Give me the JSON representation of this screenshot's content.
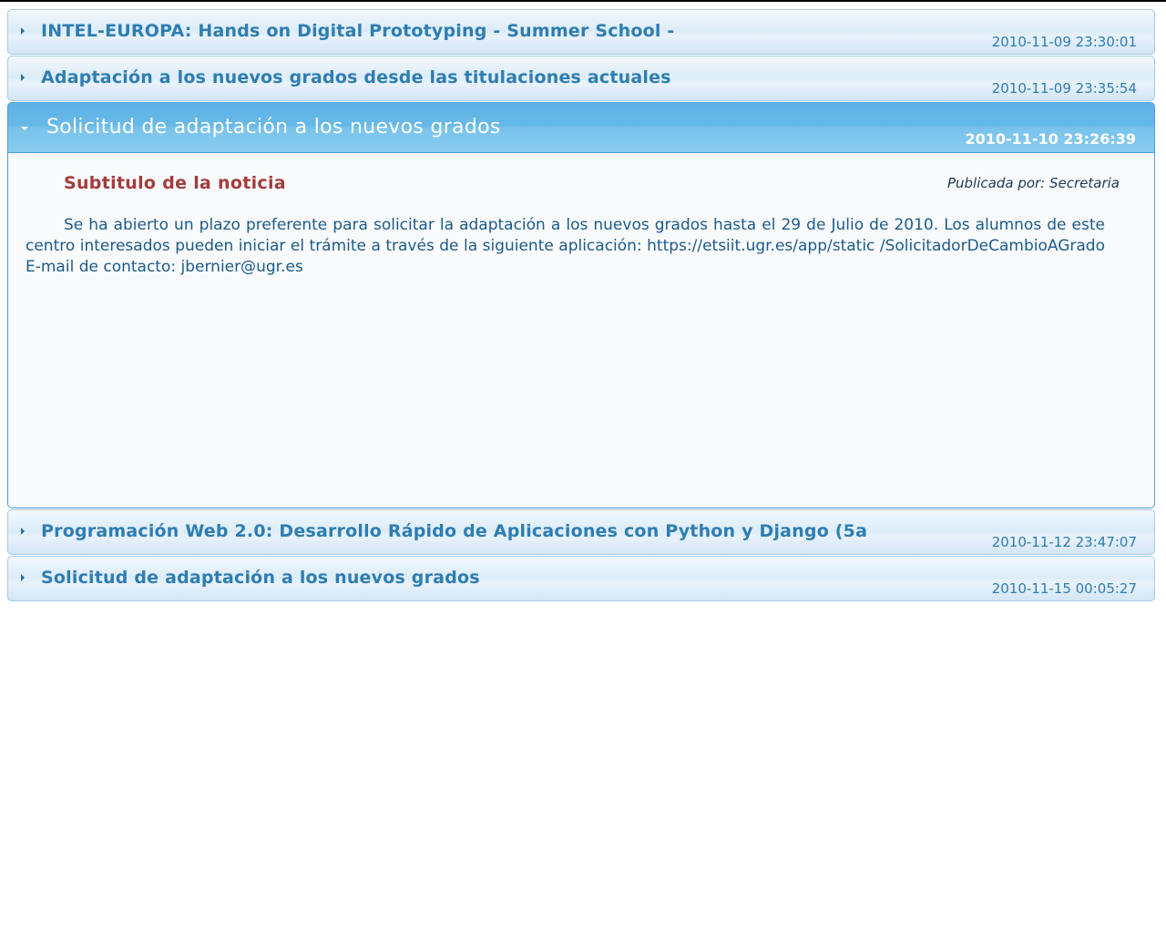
{
  "news": {
    "items": [
      {
        "title": "INTEL-EUROPA: Hands on Digital Prototyping - Summer School -",
        "date": "2010-11-09 23:30:01"
      },
      {
        "title": "Adaptación a los nuevos grados desde las titulaciones actuales",
        "date": "2010-11-09 23:35:54"
      },
      {
        "title": "Solicitud de adaptación a los nuevos grados",
        "date": "2010-11-10 23:26:39",
        "subtitle": "Subtitulo de la noticia",
        "author": "Publicada por: Secretaria",
        "body": "Se ha abierto un plazo preferente para solicitar la adaptación a los nuevos grados hasta el 29 de Julio de 2010. Los alumnos de este centro interesados pueden iniciar el trámite a través de la siguiente aplicación: https://etsiit.ugr.es/app/static /SolicitadorDeCambioAGrado E-mail de contacto: jbernier@ugr.es"
      },
      {
        "title": "Programación Web 2.0: Desarrollo Rápido de Aplicaciones con Python y Django (5a",
        "date": "2010-11-12 23:47:07"
      },
      {
        "title": "Solicitud de adaptación a los nuevos grados",
        "date": "2010-11-15 00:05:27"
      }
    ]
  },
  "colors": {
    "header_text": "#2e7db2",
    "active_header": "#5fb3e4",
    "subtitle": "#a33c3c",
    "body_text": "#1d5a8a"
  },
  "icons": {
    "collapsed": "triangle-right-icon",
    "expanded": "triangle-down-icon"
  }
}
